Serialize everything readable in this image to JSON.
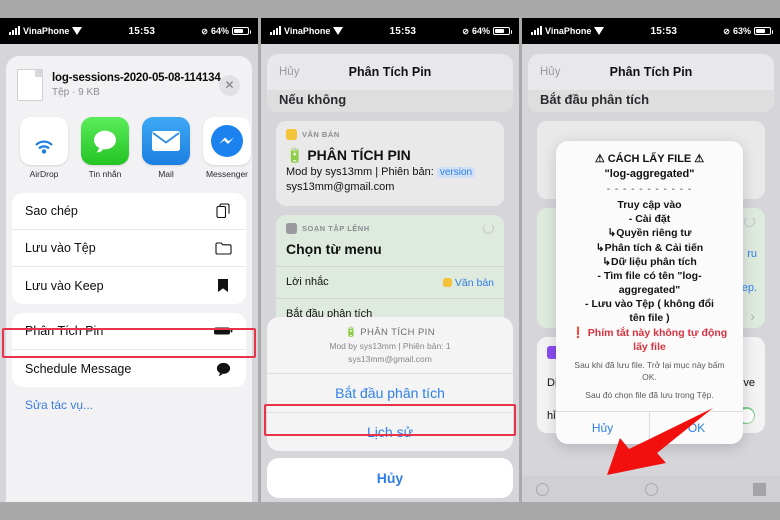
{
  "status_bar": {
    "carrier": "VinaPhone",
    "time": "15:53",
    "battery_1": "64%",
    "battery_2": "64%",
    "battery_3": "63%"
  },
  "panel1": {
    "file": {
      "name": "log-sessions-2020-05-08-114134",
      "meta": "Tệp · 9 KB",
      "close": "✕"
    },
    "apps": [
      {
        "label": "AirDrop",
        "icon": "airdrop-icon"
      },
      {
        "label": "Tin nhắn",
        "icon": "messages-icon"
      },
      {
        "label": "Mail",
        "icon": "mail-icon"
      },
      {
        "label": "Messenger",
        "icon": "messenger-icon"
      },
      {
        "label": "",
        "icon": "more-apps-icon"
      }
    ],
    "actions_group1": [
      {
        "label": "Sao chép",
        "icon": "copy-icon"
      },
      {
        "label": "Lưu vào Tệp",
        "icon": "folder-icon"
      },
      {
        "label": "Lưu vào Keep",
        "icon": "bookmark-icon"
      }
    ],
    "actions_group2": [
      {
        "label": "Phân Tích Pin",
        "icon": "battery-icon",
        "highlighted": true
      },
      {
        "label": "Schedule Message",
        "icon": "speech-bubble-icon"
      }
    ],
    "edit_link": "Sửa tác vụ..."
  },
  "panel2": {
    "nav": {
      "cancel": "Hủy",
      "title": "Phân Tích Pin"
    },
    "clipped_strip": "Nếu không",
    "card_text": {
      "kind": "VĂN BẢN",
      "line1": "PHÂN TÍCH PIN",
      "line2_a": "Mod by sys13mm | Phiên bản:",
      "line2_token": "version",
      "line3": "sys13mm@gmail.com"
    },
    "card_menu": {
      "kind": "SOẠN TẬP LỆNH",
      "title": "Chọn từ menu",
      "prompt_label": "Lời nhắc",
      "prompt_value": "Văn bản",
      "item1": "Bắt đầu phân tích"
    },
    "action_sheet": {
      "head_title": "PHÂN TÍCH PIN",
      "head_sub1": "Mod by sys13mm | Phiên bản: 1",
      "head_sub2": "sys13mm@gmail.com",
      "item_start": "Bắt đầu phân tích",
      "item_history": "Lịch sử",
      "cancel": "Hủy"
    }
  },
  "panel3": {
    "nav": {
      "cancel": "Hủy",
      "title": "Phân Tích Pin"
    },
    "header_strip": "Bắt đầu phân tích",
    "alert": {
      "title": "⚠ CÁCH LẤY FILE ⚠",
      "subtitle": "\"log-aggregated\"",
      "divider": "- - - - - - - - - - -",
      "lines": [
        "Truy cập vào",
        "- Cài đặt",
        "↳Quyền riêng tư",
        "↳Phân tích & Cải tiến",
        "↳Dữ liệu phân tích",
        "- Tìm file có tên \"log-",
        "aggregated\"",
        "- Lưu vào Tệp ( không đổi",
        "tên file )"
      ],
      "warning": "❗ Phím tắt này không tự động lấy file",
      "note1": "Sau khi đã lưu file. Trở lại mục này bấm OK.",
      "note2": "Sau đó chọn file đã lưu trong Tệp.",
      "btn_cancel": "Hủy",
      "btn_ok": "OK"
    },
    "background": {
      "service_label": "Dịch vụ",
      "icloud": "iCloud Drive",
      "toggle_label": "hỉ hỗ chọn tài liệu",
      "side_a": "ru",
      "side_b": "ep.",
      "chevron": "›"
    }
  },
  "annotation": {
    "arrow": "red-arrow-pointer",
    "arrow_color": "#f2100f",
    "highlight_color": "#e8334a"
  }
}
